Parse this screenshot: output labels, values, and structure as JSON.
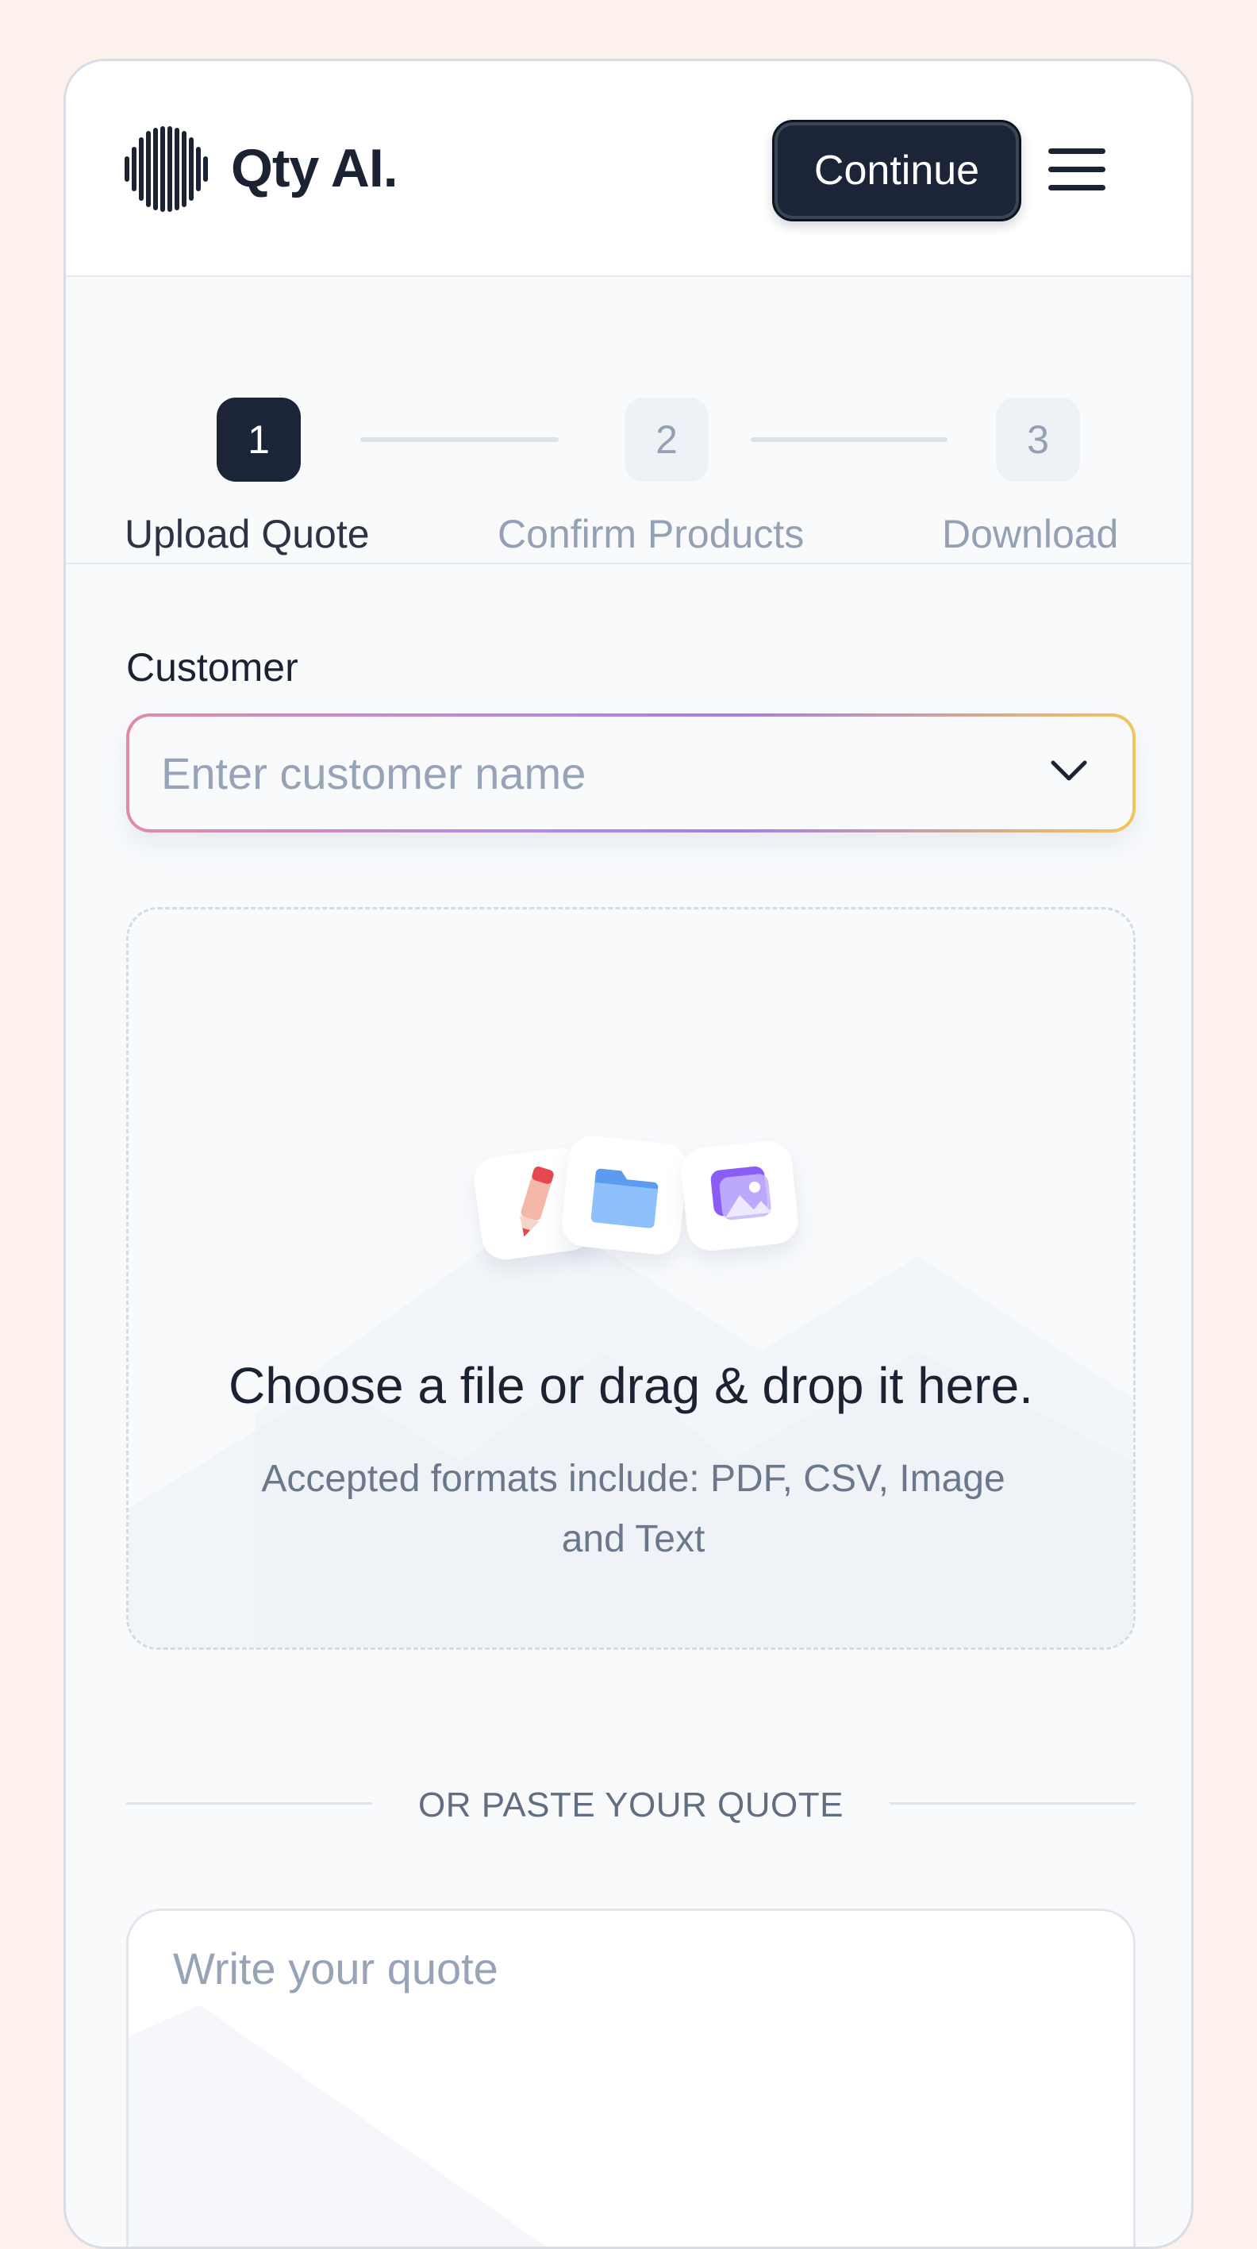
{
  "brand": {
    "name": "Qty AI."
  },
  "header": {
    "continue_label": "Continue",
    "menu_icon": "hamburger-menu-icon"
  },
  "stepper": {
    "steps": [
      {
        "number": "1",
        "label": "Upload Quote",
        "state": "active"
      },
      {
        "number": "2",
        "label": "Confirm Products",
        "state": "idle"
      },
      {
        "number": "3",
        "label": "Download",
        "state": "idle"
      }
    ]
  },
  "customer": {
    "label": "Customer",
    "placeholder": "Enter customer name",
    "value": "",
    "dropdown_icon": "chevron-down-icon"
  },
  "upload": {
    "title": "Choose a file or drag & drop it here.",
    "subtitle": "Accepted formats include: PDF, CSV, Image and Text",
    "icons": [
      "pencil-icon",
      "folder-icon",
      "image-icon"
    ]
  },
  "paste": {
    "divider_text": "OR PASTE YOUR QUOTE",
    "placeholder": "Write your quote"
  },
  "colors": {
    "primary": "#1b2537",
    "background": "#f8fafc",
    "outer_background": "#fdf1ec",
    "muted_text": "#94a0b3"
  }
}
